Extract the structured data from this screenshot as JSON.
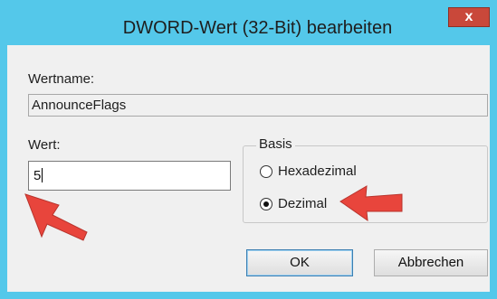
{
  "dialog": {
    "title": "DWORD-Wert (32-Bit) bearbeiten",
    "close_glyph": "x",
    "value_name_label": "Wertname:",
    "value_name": "AnnounceFlags",
    "value_data_label": "Wert:",
    "value_data": "5",
    "base": {
      "label": "Basis",
      "options": [
        {
          "label": "Hexadezimal",
          "selected": false
        },
        {
          "label": "Dezimal",
          "selected": true
        }
      ]
    },
    "ok_label": "OK",
    "cancel_label": "Abbrechen"
  },
  "annotations": {
    "arrow_color": "#e8453c"
  },
  "colors": {
    "frame": "#54c8ea",
    "client": "#f0f0f0",
    "close": "#c9483a"
  },
  "icons": [
    "close-icon",
    "red-annotation-arrow"
  ]
}
